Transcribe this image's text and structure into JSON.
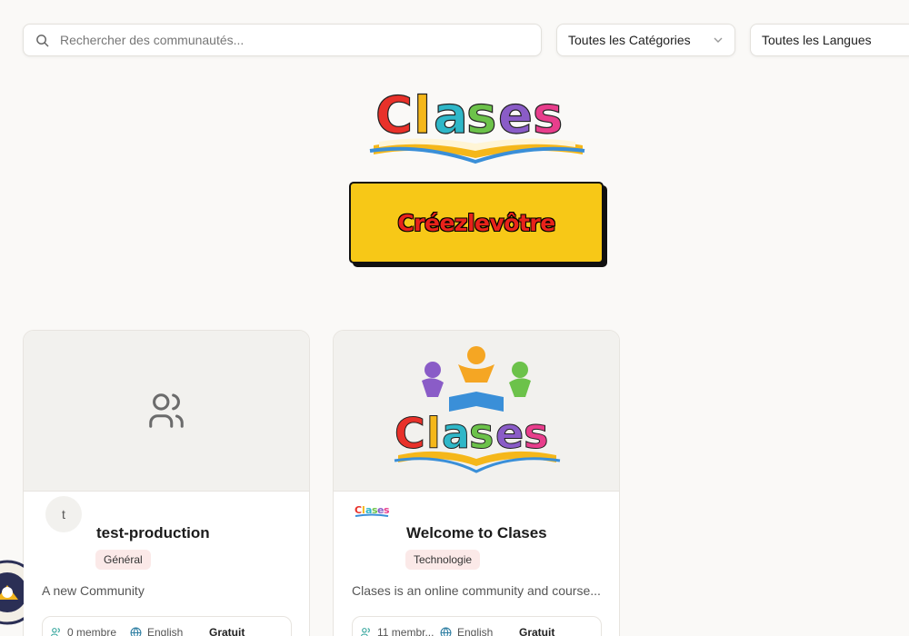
{
  "search": {
    "placeholder": "Rechercher des communautés...",
    "icon": "search-icon"
  },
  "filters": {
    "category": "Toutes les Catégories",
    "language": "Toutes les Langues"
  },
  "hero": {
    "logo_text": "Clases",
    "create_label": "Créezlevôtre"
  },
  "colors": {
    "create_bg": "#f7c817",
    "create_text": "#e8231a",
    "badge_bg": "#fbe9e8",
    "page_bg": "#faf9f7"
  },
  "communities": [
    {
      "avatar_letter": "t",
      "name": "test-production",
      "category": "Général",
      "description": "A new Community",
      "members": "0 membre",
      "language": "English",
      "price": "Gratuit",
      "banner_icon": "users-icon"
    },
    {
      "avatar_logo_text": "Clases",
      "name": "Welcome to Clases",
      "category": "Technologie",
      "description": "Clases is an online community and course...",
      "members": "11 membr...",
      "language": "English",
      "price": "Gratuit",
      "banner_logo_text": "Clases"
    }
  ]
}
